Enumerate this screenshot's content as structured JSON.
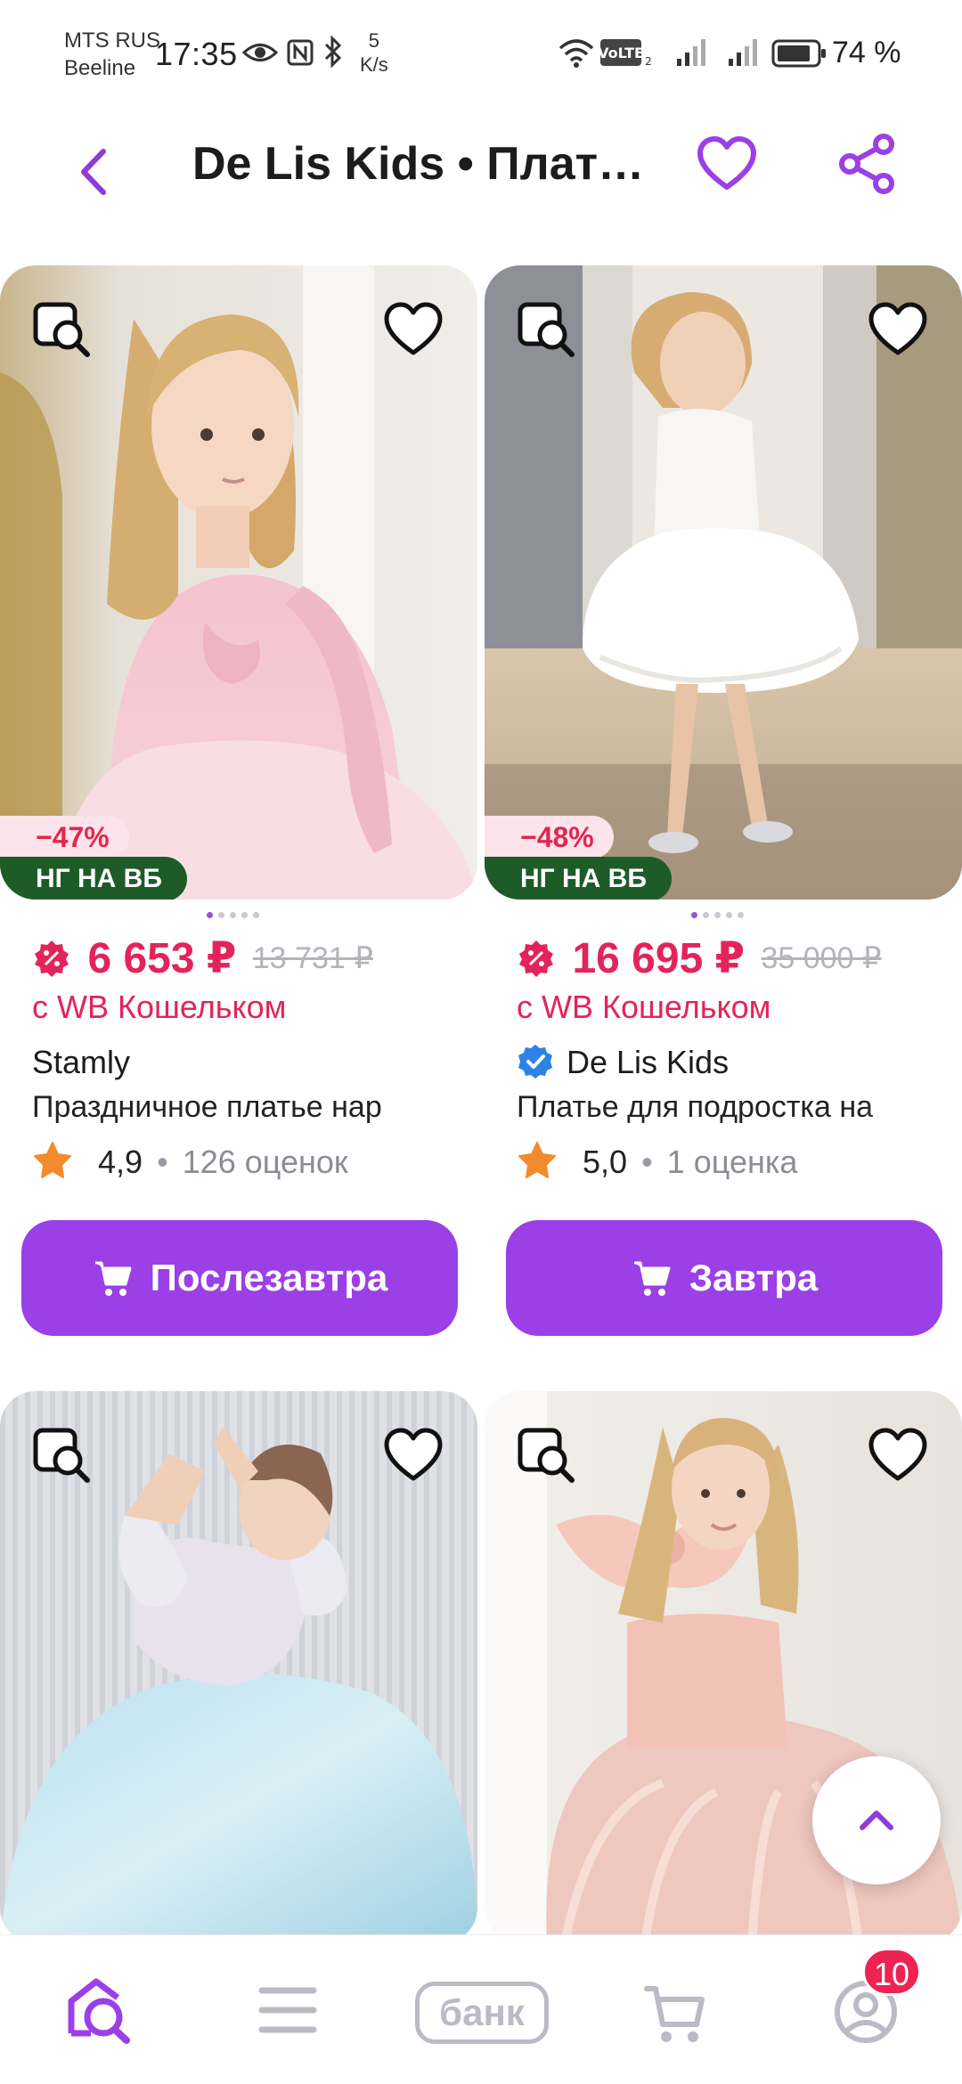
{
  "status_bar": {
    "carrier1": "MTS RUS",
    "carrier2": "Beeline",
    "time": "17:35",
    "speed_value": "5",
    "speed_unit": "K/s",
    "battery": "74 %",
    "icons": [
      "eye-icon",
      "nfc-icon",
      "bluetooth-icon",
      "wifi-icon",
      "volte-icon",
      "signal-icon",
      "signal-icon",
      "battery-icon"
    ]
  },
  "header": {
    "title": "De Lis Kids • Плать..."
  },
  "colors": {
    "accent": "#9b3fe6",
    "price": "#e3245a",
    "promo_badge": "#1d5c29"
  },
  "products": [
    {
      "discount": "−47%",
      "promo": "НГ НА ВБ",
      "price": "6 653 ₽",
      "old_price": "13 731 ₽",
      "wallet": "с WB Кошельком",
      "brand": "Stamly",
      "name": "Праздничное платье нар",
      "rating": "4,9",
      "reviews": "126 оценок",
      "delivery": "Послезавтра"
    },
    {
      "discount": "−48%",
      "promo": "НГ НА ВБ",
      "price": "16 695 ₽",
      "old_price": "35 000 ₽",
      "wallet": "с WB Кошельком",
      "brand": "De Lis Kids",
      "name": "Платье для подростка на",
      "rating": "5,0",
      "reviews": "1 оценка",
      "delivery": "Завтра"
    }
  ],
  "separator": "•",
  "bottom_nav": {
    "items": [
      "home-search-icon",
      "catalog-icon",
      "bank",
      "cart-icon",
      "profile-icon"
    ],
    "bank_label": "банк",
    "profile_badge": "10"
  }
}
